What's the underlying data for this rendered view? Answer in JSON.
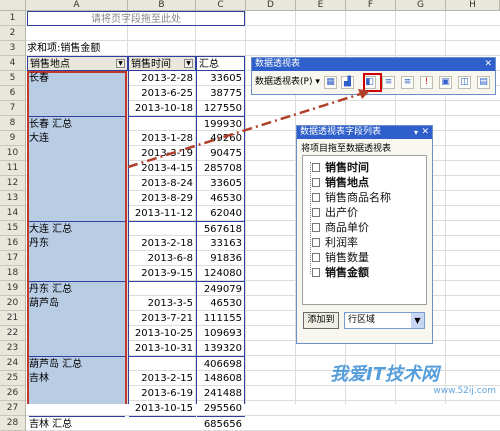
{
  "columns": [
    "A",
    "B",
    "C",
    "D",
    "E",
    "F",
    "G",
    "H"
  ],
  "rows": [
    "1",
    "2",
    "3",
    "4",
    "5",
    "6",
    "7",
    "8",
    "9",
    "10",
    "11",
    "12",
    "13",
    "14",
    "15",
    "16",
    "17",
    "18",
    "19",
    "20",
    "21",
    "22",
    "23",
    "24",
    "25",
    "26",
    "27",
    "28"
  ],
  "drop_hint": "请将页字段拖至此处",
  "pivot": {
    "title": "求和项:销售金额",
    "row_field": "销售地点",
    "col_field": "销售时间",
    "sum_header": "汇总",
    "records": [
      {
        "place": "长春",
        "date": "2013-2-28",
        "value": "33605"
      },
      {
        "place": "",
        "date": "2013-6-25",
        "value": "38775"
      },
      {
        "place": "",
        "date": "2013-10-18",
        "value": "127550"
      },
      {
        "place": "长春 汇总",
        "date": "",
        "value": "199930"
      },
      {
        "place": "大连",
        "date": "2013-1-28",
        "value": "49260"
      },
      {
        "place": "",
        "date": "2013-3-19",
        "value": "90475"
      },
      {
        "place": "",
        "date": "2013-4-15",
        "value": "285708"
      },
      {
        "place": "",
        "date": "2013-8-24",
        "value": "33605"
      },
      {
        "place": "",
        "date": "2013-8-29",
        "value": "46530"
      },
      {
        "place": "",
        "date": "2013-11-12",
        "value": "62040"
      },
      {
        "place": "大连 汇总",
        "date": "",
        "value": "567618"
      },
      {
        "place": "丹东",
        "date": "2013-2-18",
        "value": "33163"
      },
      {
        "place": "",
        "date": "2013-6-8",
        "value": "91836"
      },
      {
        "place": "",
        "date": "2013-9-15",
        "value": "124080"
      },
      {
        "place": "丹东 汇总",
        "date": "",
        "value": "249079"
      },
      {
        "place": "葫芦岛",
        "date": "2013-3-5",
        "value": "46530"
      },
      {
        "place": "",
        "date": "2013-7-21",
        "value": "111155"
      },
      {
        "place": "",
        "date": "2013-10-25",
        "value": "109693"
      },
      {
        "place": "",
        "date": "2013-10-31",
        "value": "139320"
      },
      {
        "place": "葫芦岛 汇总",
        "date": "",
        "value": "406698"
      },
      {
        "place": "吉林",
        "date": "2013-2-15",
        "value": "148608"
      },
      {
        "place": "",
        "date": "2013-6-19",
        "value": "241488"
      },
      {
        "place": "",
        "date": "2013-10-15",
        "value": "295560"
      },
      {
        "place": "吉林 汇总",
        "date": "",
        "value": "685656"
      }
    ]
  },
  "pivot_toolbar": {
    "title": "数据透视表",
    "menu_label": "数据透视表(P)",
    "icons": [
      "format-report-icon",
      "chart-wizard-icon",
      "wizard-icon",
      "hide-detail-icon",
      "show-detail-icon",
      "refresh-icon",
      "include-hidden-icon",
      "field-settings-icon",
      "field-list-icon",
      "show-items-icon"
    ]
  },
  "field_list": {
    "title": "数据透视表字段列表",
    "instruction": "将项目拖至数据透视表",
    "fields": [
      {
        "name": "销售时间",
        "bold": true
      },
      {
        "name": "销售地点",
        "bold": true
      },
      {
        "name": "销售商品名称",
        "bold": false
      },
      {
        "name": "出产价",
        "bold": false
      },
      {
        "name": "商品单价",
        "bold": false
      },
      {
        "name": "利润率",
        "bold": false
      },
      {
        "name": "销售数量",
        "bold": false
      },
      {
        "name": "销售金额",
        "bold": true
      }
    ],
    "add_button": "添加到",
    "area_select": "行区域"
  },
  "watermark": {
    "brand": "我爱IT技术网",
    "url": "www.52ij.com"
  },
  "colors": {
    "selection": "#b8cce4",
    "titlebar": "#2f5fcb",
    "highlight_red": "#d10000"
  }
}
